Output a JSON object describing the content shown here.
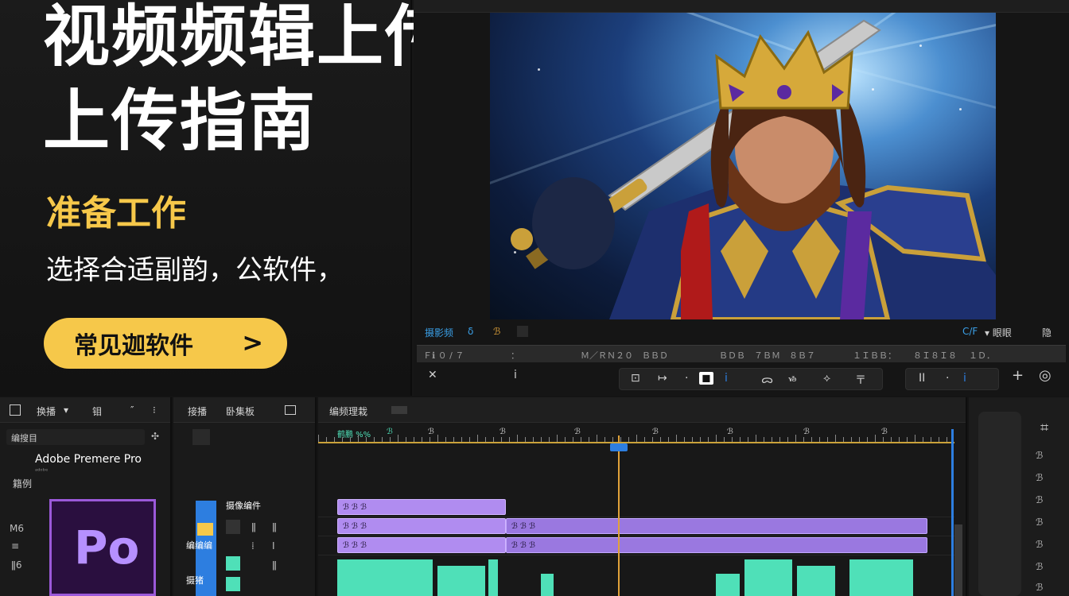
{
  "hero": {
    "title_line1": "视频频辑上传Po",
    "title_line2": "上传指南",
    "subtitle": "准备工作",
    "description": "选择合适副韵，公软件，",
    "cta_label": "常见迦软件",
    "cta_icon": "chevron-right-icon",
    "accent_color": "#f6c84a"
  },
  "monitor": {
    "status_left": "摄影频",
    "status_left_2": "δ",
    "status_left_3": "ℬ",
    "status_right_1": "C/F",
    "status_right_2": "▾ 眼眼",
    "status_right_3": "隐",
    "ruler_labels": [
      "Ｆℹ ０ / ７",
      "：",
      "Ｍ／ＲＮ２０　ＢＢＤ",
      "ＢＤＢ　７ＢＭ　８Ｂ７",
      "１ＩＢＢ：",
      "８Ｉ８Ｉ８",
      "１Ｄ．"
    ],
    "controls_left": [
      "✕",
      "ⅰ"
    ],
    "controls_center": [
      "⊡",
      "↦",
      "·",
      "◼",
      "ⅰ",
      "ᯅ",
      "ᏹ",
      "⟡",
      "〒"
    ],
    "controls_right": [
      "ⅠⅠ",
      "·",
      "ⅰ"
    ],
    "add_icon": "+",
    "settings_icon": "◎"
  },
  "panels": {
    "p1": {
      "tab1": "换播",
      "tab1_icon": "▾",
      "tab2": "钼",
      "tab3": "″",
      "tab3_b": "⁝",
      "search_label": "编搜目",
      "item_title": "Adobe Premere Pro",
      "item_caption": "ᵃᵈᵒᵇᵉ",
      "item_sub": "籍例",
      "side_labels": [
        "M6",
        "≡",
        "ǁ6"
      ],
      "tile_label": "Po"
    },
    "p2": {
      "tab1": "接播",
      "tab2": "卧集板",
      "track_label": "摄像编件",
      "row_label_1": "编编编",
      "row_label_2": "摄猪",
      "row_cells": [
        "ǁ",
        "⁞",
        "ǁ",
        "Ⅰ",
        "ǁ"
      ]
    },
    "p3": {
      "title": "编频理栽",
      "ruler_labels": [
        "鹤鹏 %%",
        "ℬ",
        "ℬ",
        "ℬ",
        "ℬ",
        "ℬ",
        "ℬ",
        "ℬ",
        "ℬ"
      ],
      "clip_labels": [
        "ℬ ℬ ℬ",
        "ℬ ℬ ℬ",
        "ℬ ℬ ℬ",
        "ℬ ℬ ℬ",
        "ℬ ℬ ℬ"
      ]
    },
    "p4": {
      "tool": "⌗",
      "side_items": [
        "ℬ",
        "ℬ",
        "ℬ",
        "ℬ",
        "ℬ",
        "ℬ",
        "ℬ"
      ]
    }
  },
  "colors": {
    "panel_bg": "#1a1a1a",
    "clip_purple": "#b08cf0",
    "clip_green": "#4fe0b8",
    "playhead": "#e0a23a",
    "premiere_purple": "#9b59d9"
  }
}
